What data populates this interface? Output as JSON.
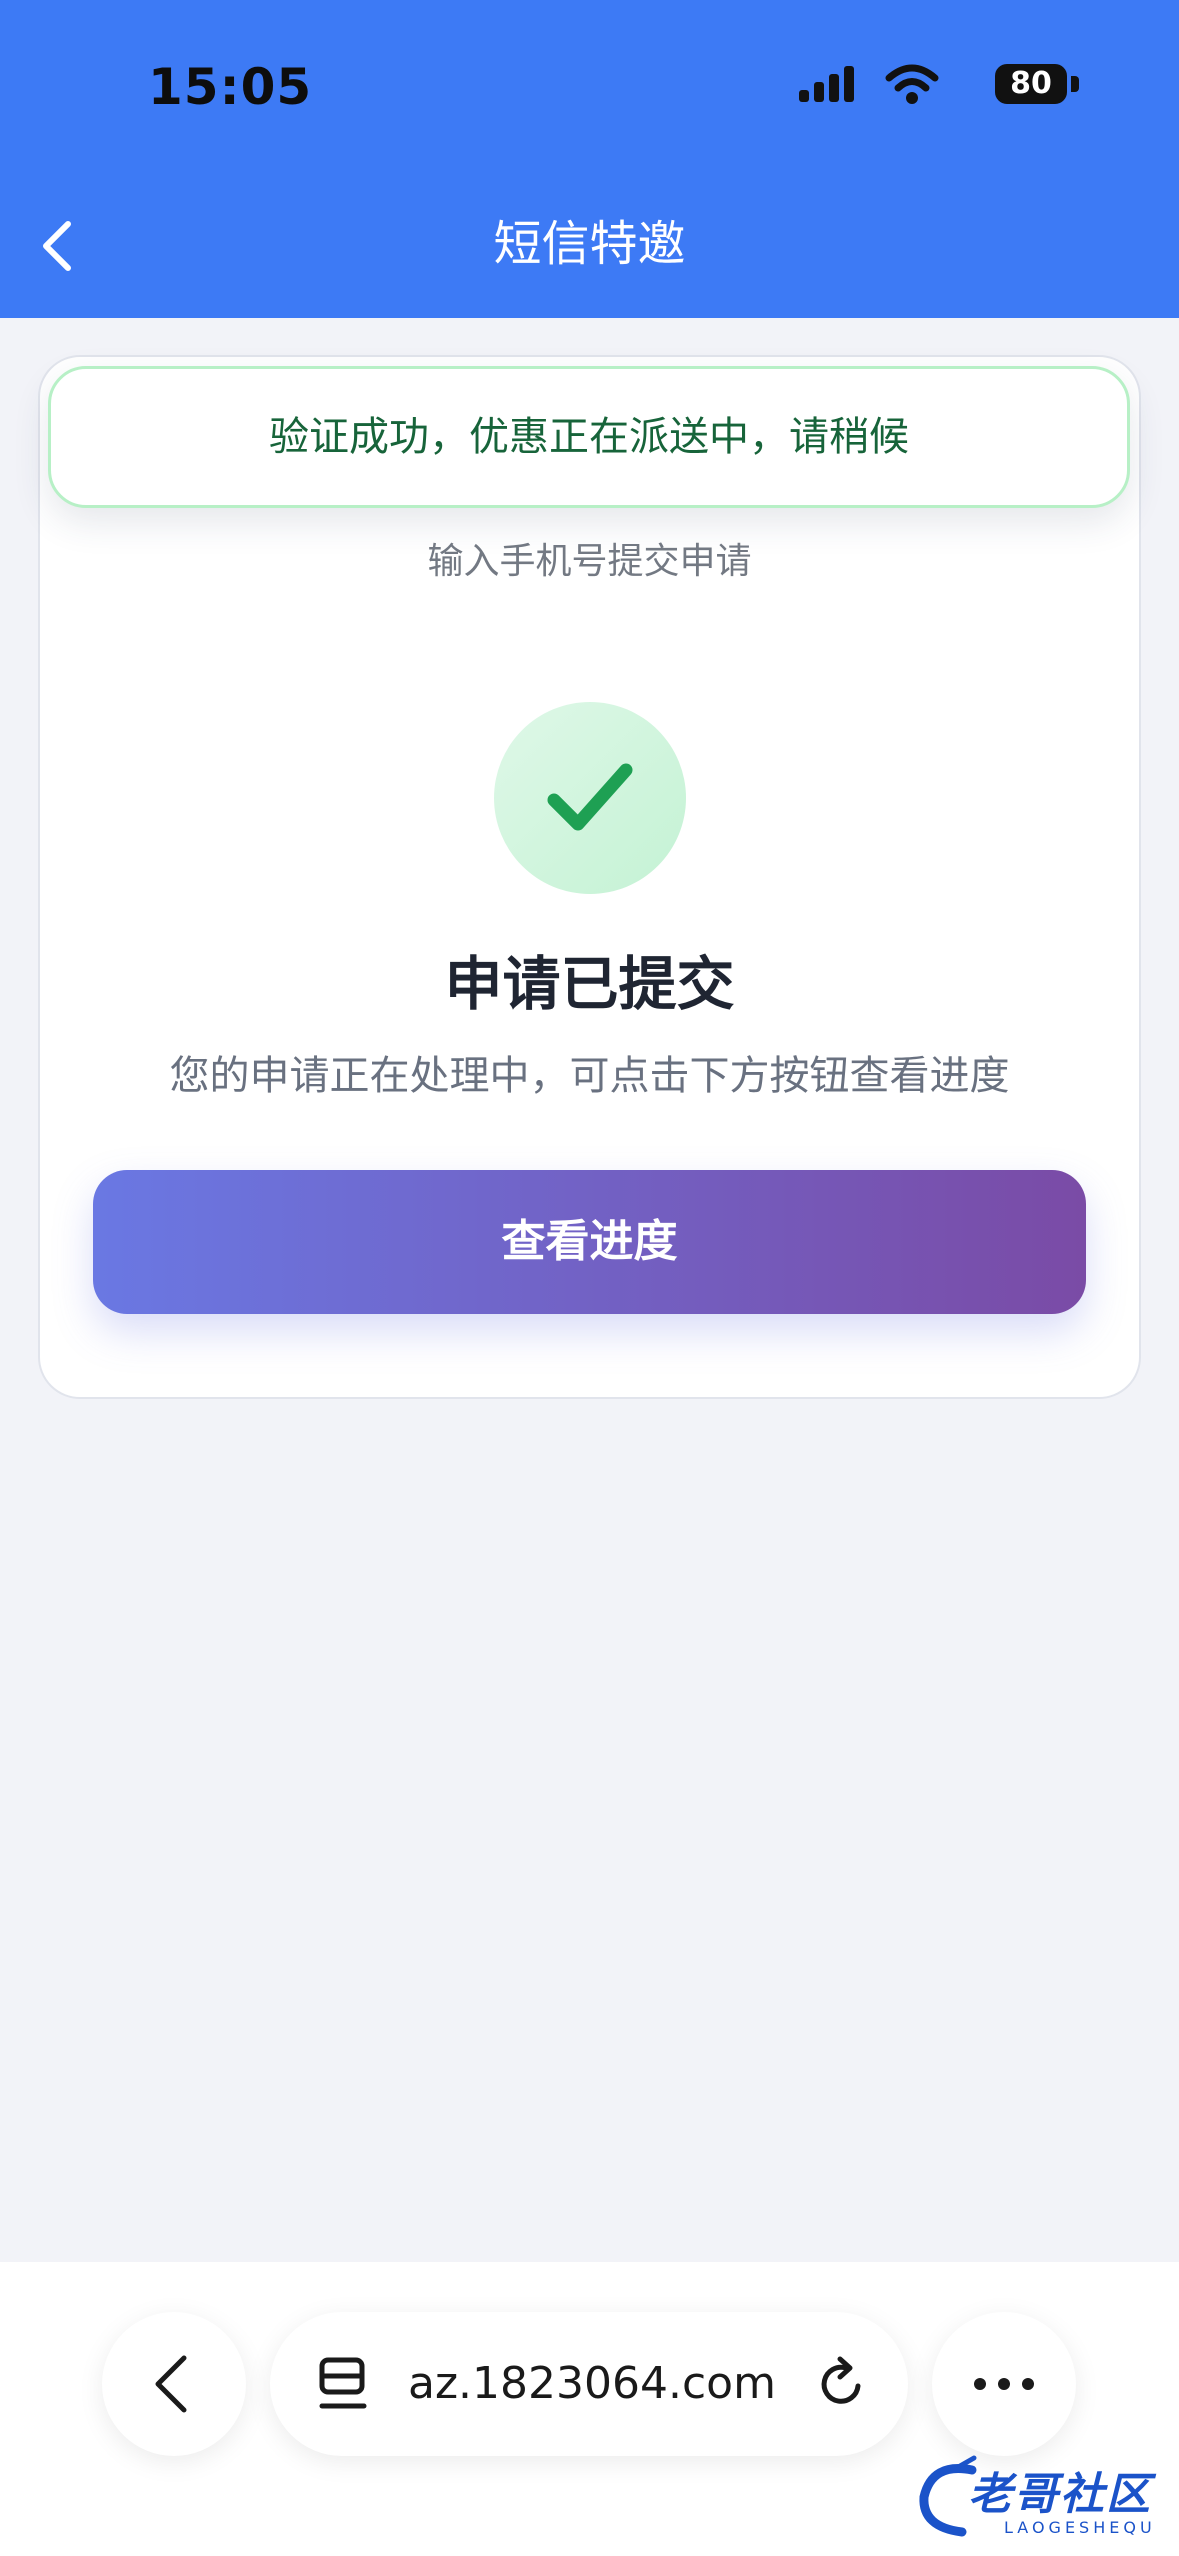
{
  "status_bar": {
    "time": "15:05",
    "battery": "80",
    "icons": [
      "signal-icon",
      "wifi-icon",
      "battery-icon"
    ]
  },
  "header": {
    "title": "短信特邀",
    "back_icon": "chevron-left-icon",
    "color": "#3d7af5"
  },
  "toast": {
    "message": "验证成功，优惠正在派送中，请稍候"
  },
  "card": {
    "subtitle": "输入手机号提交申请",
    "status_icon": "check-icon",
    "result_title": "申请已提交",
    "result_desc": "您的申请正在处理中，可点击下方按钮查看进度",
    "button_label": "查看进度"
  },
  "browser": {
    "url": "az.1823064.com",
    "icons": [
      "chevron-left-icon",
      "tabs-icon",
      "reload-icon",
      "more-icon"
    ]
  },
  "watermark": {
    "text": "老哥社区",
    "sub": "LAOGESHEQU"
  }
}
